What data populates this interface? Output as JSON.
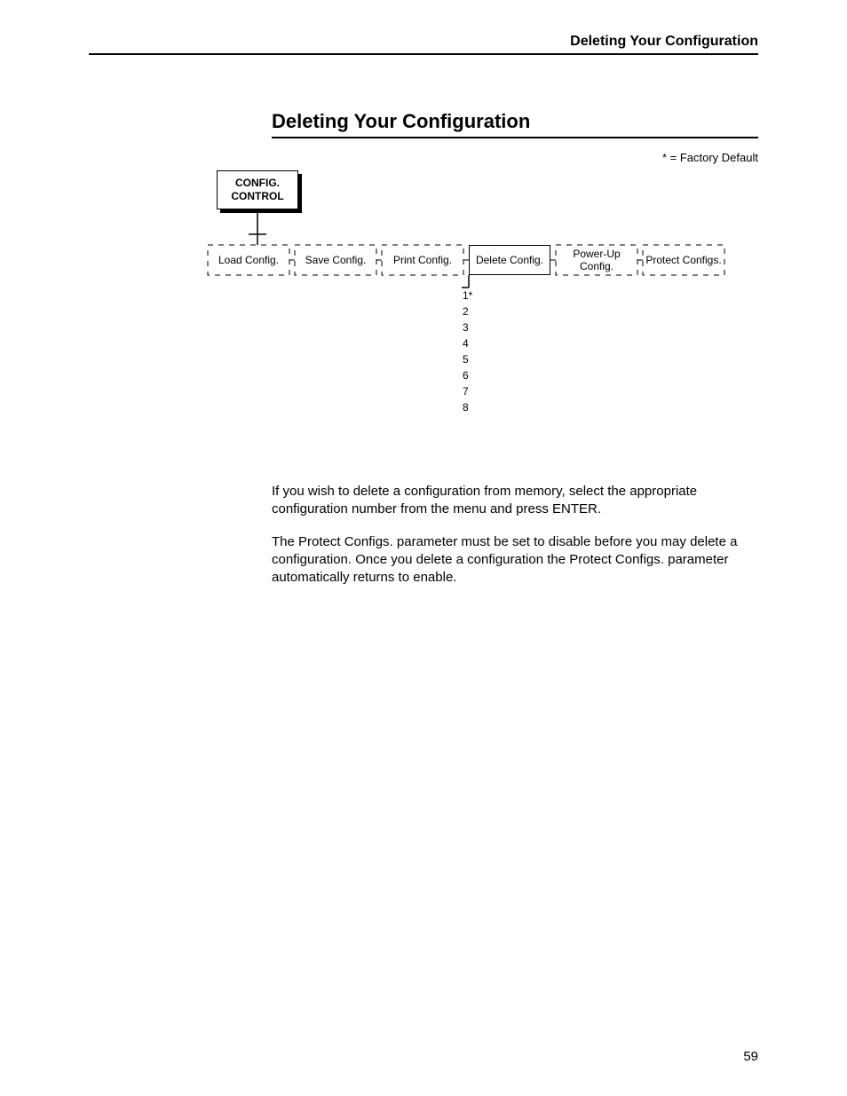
{
  "header": {
    "title": "Deleting Your Configuration"
  },
  "section": {
    "heading": "Deleting Your Configuration"
  },
  "legend": "* = Factory Default",
  "root": {
    "line1": "CONFIG.",
    "line2": "CONTROL"
  },
  "menu": {
    "load": "Load Config.",
    "save": "Save Config.",
    "print": "Print Config.",
    "delete": "Delete Config.",
    "powerup": "Power-Up Config.",
    "protect": "Protect Configs."
  },
  "options": [
    "1*",
    "2",
    "3",
    "4",
    "5",
    "6",
    "7",
    "8"
  ],
  "body": {
    "p1": "If you wish to delete a configuration from memory, select the appropriate configuration number from the menu and press ENTER.",
    "p2": "The Protect Configs. parameter must be set to disable before you may delete a configuration. Once you delete a configuration the Protect Configs. parameter automatically returns to enable."
  },
  "page_number": "59"
}
